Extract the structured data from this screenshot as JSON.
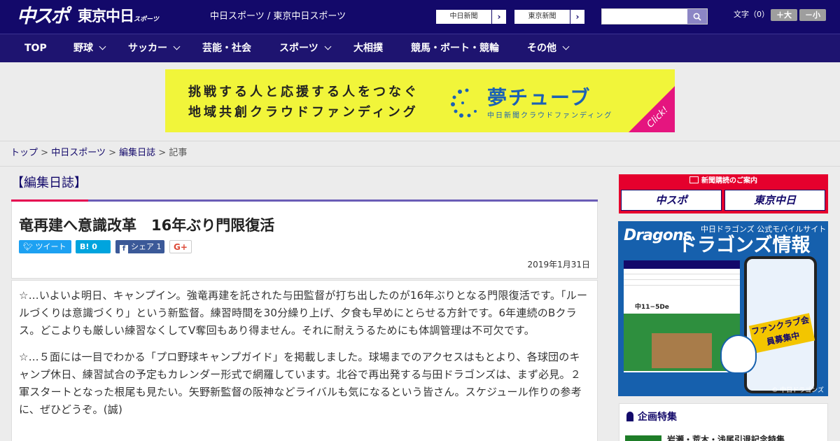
{
  "header": {
    "logo_main": "中スポ",
    "logo_tokyo": "東京中日",
    "logo_tokyo_sub": "スポーツ",
    "site_title": "中日スポーツ / 東京中日スポーツ",
    "paper_links": [
      {
        "label": "中日新聞",
        "arrow": "›"
      },
      {
        "label": "東京新聞",
        "arrow": "›"
      }
    ],
    "search": {
      "value": "",
      "placeholder": ""
    },
    "font_size": {
      "label": "文字（0）",
      "larger": "＋大",
      "smaller": "－小"
    }
  },
  "nav": {
    "items": [
      {
        "label": "TOP",
        "dropdown": false
      },
      {
        "label": "野球",
        "dropdown": true
      },
      {
        "label": "サッカー",
        "dropdown": true
      },
      {
        "label": "芸能・社会",
        "dropdown": false
      },
      {
        "label": "スポーツ",
        "dropdown": true
      },
      {
        "label": "大相撲",
        "dropdown": false
      },
      {
        "label": "競馬・ボート・競輪",
        "dropdown": false
      },
      {
        "label": "その他",
        "dropdown": true
      }
    ]
  },
  "banner": {
    "line1": "挑戦する人と応援する人をつなぐ",
    "line2": "地域共創クラウドファンディング",
    "brand": "夢チューブ",
    "brand_sub": "中日新聞クラウドファンディング",
    "cta": "Click!",
    "colors": {
      "background": "#f1f53a",
      "brand": "#1b61b5",
      "cta": "#e5157f"
    }
  },
  "breadcrumb": {
    "items": [
      {
        "label": "トップ",
        "link": true
      },
      {
        "label": "中日スポーツ",
        "link": true
      },
      {
        "label": "編集日誌",
        "link": true
      },
      {
        "label": "記事",
        "link": false
      }
    ],
    "separator": ">"
  },
  "section": {
    "title": "【編集日誌】"
  },
  "article": {
    "title": "竜再建へ意識改革　16年ぶり門限復活",
    "share": {
      "tweet": "ツイート",
      "hatena": "B! 0",
      "facebook": "シェア 1",
      "gplus": "G+"
    },
    "date": "2019年1月31日",
    "paragraphs": [
      "☆…いよいよ明日、キャンプイン。強竜再建を託された与田監督が打ち出したのが16年ぶりとなる門限復活です。「ルールづくりは意識づくり」という新監督。練習時間を30分繰り上げ、夕食も早めにとらせる方針です。6年連続のBクラス。どこよりも厳しい練習なくしてV奪回もあり得ません。それに耐えうるためにも体調管理は不可欠です。",
      "☆…５面には一目でわかる「プロ野球キャンプガイド」を掲載しました。球場までのアクセスはもとより、各球団のキャンプ休日、練習試合の予定もカレンダー形式で網羅しています。北谷で再出発する与田ドラゴンズは、まず必見。２軍スタートとなった根尾も見たい。矢野新監督の阪神などライバルも気になるという皆さん。スケジュール作りの参考に、ぜひどうぞ。(誠)"
    ]
  },
  "sidebar": {
    "subscription": {
      "heading": "新聞購読のご案内",
      "buttons": [
        "中スポ",
        "東京中日"
      ]
    },
    "dragons_ad": {
      "logo": "Dragons",
      "tagline": "中日ドラゴンズ 公式モバイルサイト",
      "title": "ドラゴンズ情報",
      "score": "中11−5De",
      "phone_banner": "ファンクラブ会員募集中",
      "copyright": "© 中日ドラゴンズ"
    },
    "feature": {
      "title": "企画特集",
      "item": "岩瀬・荒木・浅尾引退記念特集"
    }
  },
  "colors": {
    "header_bg": "#13096a",
    "nav_bg": "#1e1470",
    "accent_red": "#e5004f",
    "section_rule": "#6a5cb6"
  }
}
